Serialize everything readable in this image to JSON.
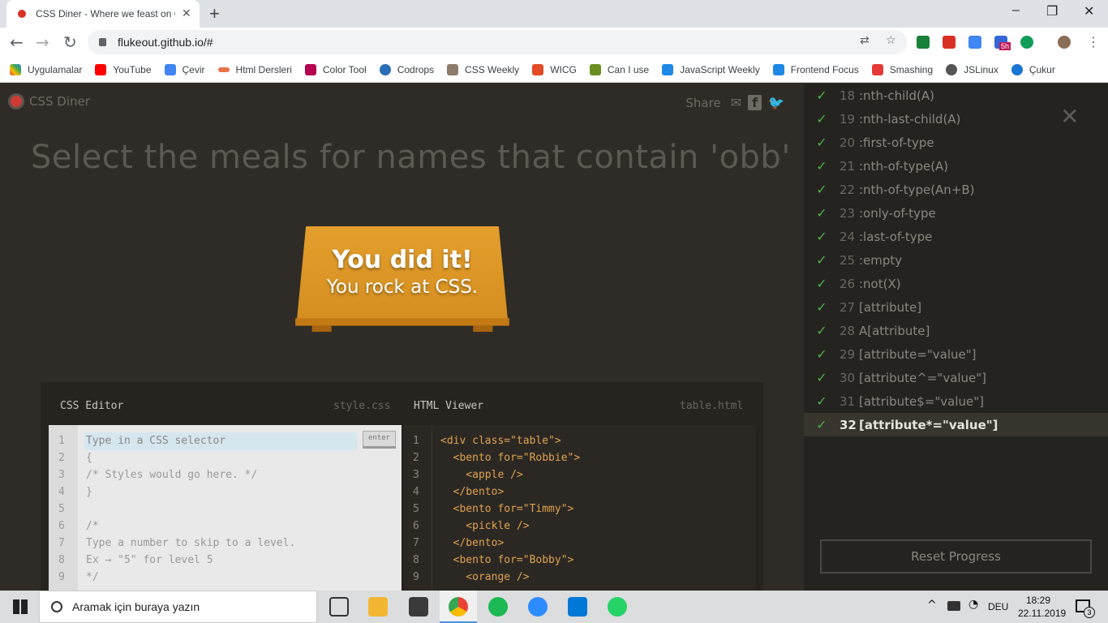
{
  "browser": {
    "tab_title": "CSS Diner - Where we feast on C",
    "url": "flukeout.github.io/#",
    "bookmarks": [
      "Uygulamalar",
      "YouTube",
      "Çevir",
      "Html Dersleri",
      "Color Tool",
      "Codrops",
      "CSS Weekly",
      "WICG",
      "Can I use",
      "JavaScript Weekly",
      "Frontend Focus",
      "Smashing",
      "JSLinux",
      "Çukur"
    ],
    "badge": "5h"
  },
  "page": {
    "logo": "CSS Diner",
    "share_label": "Share",
    "instruction": "Select the meals for names that contain 'obb'",
    "win_title": "You did it!",
    "win_subtitle": "You rock at CSS."
  },
  "editor": {
    "css_title": "CSS Editor",
    "css_file": "style.css",
    "html_title": "HTML Viewer",
    "html_file": "table.html",
    "input_placeholder": "Type in a CSS selector",
    "enter_label": "enter",
    "css_lines": [
      "",
      "{",
      "/* Styles would go here. */",
      "}",
      "",
      "/*",
      "Type a number to skip to a level.",
      "Ex → \"5\" for level 5",
      "*/"
    ],
    "html_lines": [
      "<div class=\"table\">",
      "  <bento for=\"Robbie\">",
      "    <apple />",
      "  </bento>",
      "  <bento for=\"Timmy\">",
      "    <pickle />",
      "  </bento>",
      "  <bento for=\"Bobby\">",
      "    <orange />"
    ]
  },
  "sidebar": {
    "levels": [
      {
        "num": "18",
        "name": ":nth-child(A)"
      },
      {
        "num": "19",
        "name": ":nth-last-child(A)"
      },
      {
        "num": "20",
        "name": ":first-of-type"
      },
      {
        "num": "21",
        "name": ":nth-of-type(A)"
      },
      {
        "num": "22",
        "name": ":nth-of-type(An+B)"
      },
      {
        "num": "23",
        "name": ":only-of-type"
      },
      {
        "num": "24",
        "name": ":last-of-type"
      },
      {
        "num": "25",
        "name": ":empty"
      },
      {
        "num": "26",
        "name": ":not(X)"
      },
      {
        "num": "27",
        "name": "[attribute]"
      },
      {
        "num": "28",
        "name": "A[attribute]"
      },
      {
        "num": "29",
        "name": "[attribute=\"value\"]"
      },
      {
        "num": "30",
        "name": "[attribute^=\"value\"]"
      },
      {
        "num": "31",
        "name": "[attribute$=\"value\"]"
      },
      {
        "num": "32",
        "name": "[attribute*=\"value\"]"
      }
    ],
    "active_level": "32",
    "reset_label": "Reset Progress"
  },
  "taskbar": {
    "search_placeholder": "Aramak için buraya yazın",
    "lang": "DEU",
    "time": "18:29",
    "date": "22.11.2019",
    "notifications": "3"
  },
  "colors": {
    "accent_orange": "#e09a2b",
    "check_green": "#4cae4c",
    "logo_red": "#ce3b32"
  }
}
